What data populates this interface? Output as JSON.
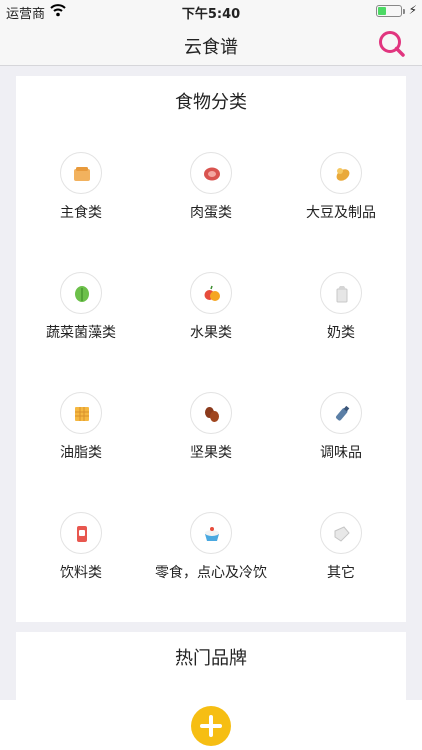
{
  "status_bar": {
    "carrier": "运营商",
    "time": "下午5:40",
    "battery_level": 0.35
  },
  "nav": {
    "title": "云食谱",
    "search_icon": "magnifier-icon"
  },
  "categories_section": {
    "title": "食物分类",
    "items": [
      {
        "label": "主食类",
        "icon": "staple-food-icon"
      },
      {
        "label": "肉蛋类",
        "icon": "meat-icon"
      },
      {
        "label": "大豆及制品",
        "icon": "soybean-icon"
      },
      {
        "label": "蔬菜菌藻类",
        "icon": "leafy-vegetable-icon"
      },
      {
        "label": "水果类",
        "icon": "fruit-icon"
      },
      {
        "label": "奶类",
        "icon": "milk-icon"
      },
      {
        "label": "油脂类",
        "icon": "oil-fat-icon"
      },
      {
        "label": "坚果类",
        "icon": "nut-icon"
      },
      {
        "label": "调味品",
        "icon": "seasoning-icon"
      },
      {
        "label": "饮料类",
        "icon": "drink-icon"
      },
      {
        "label": "零食，点心及冷饮",
        "icon": "snack-cake-icon"
      },
      {
        "label": "其它",
        "icon": "other-food-icon"
      }
    ]
  },
  "brands_section": {
    "title": "热门品牌"
  },
  "bottom": {
    "add_icon": "plus-icon"
  },
  "colors": {
    "accent": "#e1357f",
    "add_button": "#f6be13",
    "battery": "#4cd964"
  }
}
